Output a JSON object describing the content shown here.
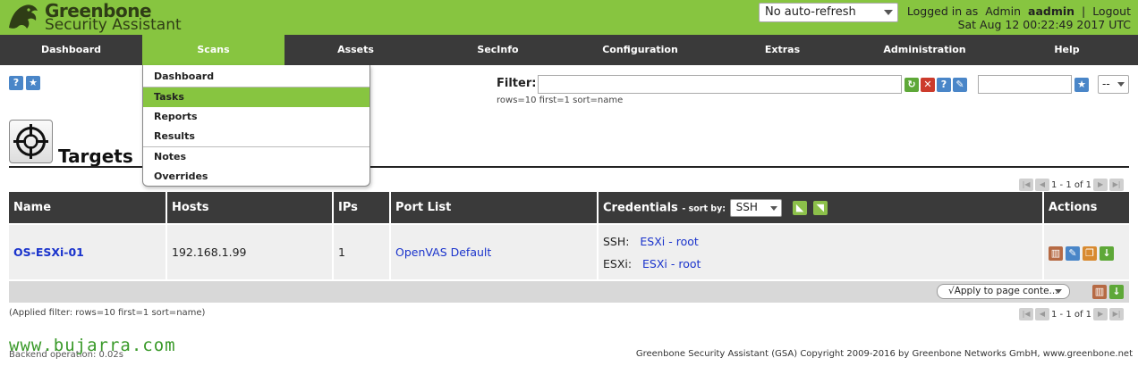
{
  "header": {
    "brand_line1": "Greenbone",
    "brand_line2": "Security Assistant",
    "refresh_select": "No auto-refresh",
    "logged_in_prefix": "Logged in as",
    "role": "Admin",
    "username": "aadmin",
    "separator": "|",
    "logout": "Logout",
    "datetime": "Sat Aug 12 00:22:49 2017 UTC"
  },
  "nav": {
    "items": [
      "Dashboard",
      "Scans",
      "Assets",
      "SecInfo",
      "Configuration",
      "Extras",
      "Administration",
      "Help"
    ],
    "active": "Scans"
  },
  "scans_menu": {
    "items": [
      "Dashboard",
      "Tasks",
      "Reports",
      "Results",
      "Notes",
      "Overrides"
    ],
    "selected": "Tasks"
  },
  "toolbar": {
    "help_icon": "?",
    "new_icon": "★"
  },
  "filter": {
    "label": "Filter:",
    "value": "",
    "summary": "rows=10 first=1 sort=name",
    "name_value": "",
    "saved_select": "--"
  },
  "page": {
    "title": "Targets",
    "icon": "crosshair-icon"
  },
  "pager": {
    "text": "1 - 1 of 1"
  },
  "table": {
    "headers": {
      "name": "Name",
      "hosts": "Hosts",
      "ips": "IPs",
      "port_list": "Port List",
      "credentials": "Credentials",
      "sort_by": "- sort by:",
      "sort_value": "SSH",
      "actions": "Actions"
    },
    "rows": [
      {
        "name": "OS-ESXi-01",
        "hosts": "192.168.1.99",
        "ips": "1",
        "port_list": "OpenVAS Default",
        "cred1_label": "SSH:",
        "cred1_value": "ESXi - root",
        "cred2_label": "ESXi:",
        "cred2_value": "ESXi - root"
      }
    ]
  },
  "footer": {
    "apply_select": "√Apply to page conte...",
    "applied_filter": "(Applied filter: rows=10 first=1 sort=name)",
    "backend": "Backend operation: 0.02s",
    "copyright": "Greenbone Security Assistant (GSA) Copyright 2009-2016 by Greenbone Networks GmbH, www.greenbone.net",
    "watermark": "www.bujarra.com"
  },
  "colors": {
    "brand_green": "#87c540",
    "nav_dark": "#3a3a3a",
    "link_blue": "#1a33cc"
  }
}
